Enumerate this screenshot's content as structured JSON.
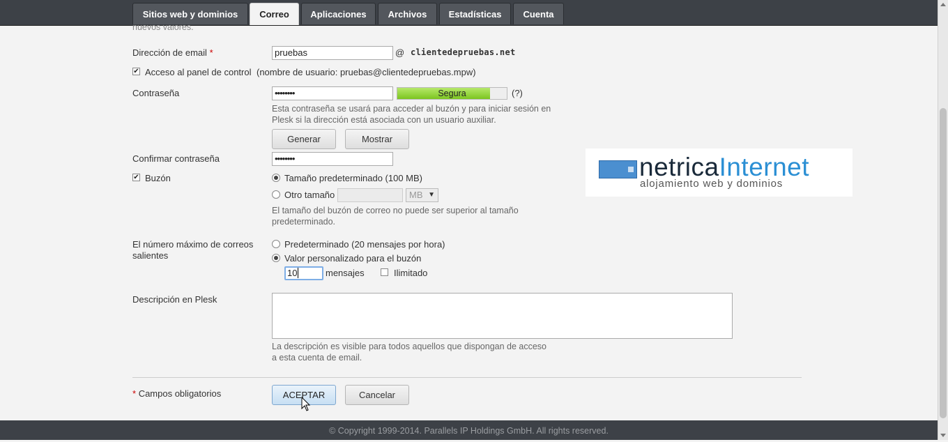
{
  "tabs": [
    {
      "label": "Sitios web y dominios"
    },
    {
      "label": "Correo"
    },
    {
      "label": "Aplicaciones"
    },
    {
      "label": "Archivos"
    },
    {
      "label": "Estadísticas"
    },
    {
      "label": "Cuenta"
    }
  ],
  "form": {
    "cut_text": "nuevos valores.",
    "email_label": "Dirección de email",
    "required_mark": "*",
    "email_value": "pruebas",
    "at_sign": "@",
    "domain": "clientedepruebas.net",
    "panel_access_label": "Acceso al panel de control",
    "panel_access_username": "(nombre de usuario: pruebas@clientedepruebas.mpw)",
    "password_label": "Contraseña",
    "password_value": "••••••••",
    "strength_label": "Segura",
    "strength_level": 0.85,
    "strength_help": "(?)",
    "password_hint": "Esta contraseña se usará para acceder al buzón y para iniciar sesión en Plesk si la dirección está asociada con un usuario auxiliar.",
    "generate_button": "Generar",
    "show_button": "Mostrar",
    "confirm_label": "Confirmar contraseña",
    "confirm_value": "••••••••",
    "mailbox_label": "Buzón",
    "default_size_label": "Tamaño predeterminado (100 MB)",
    "other_size_label": "Otro tamaño",
    "size_unit": "MB",
    "size_hint": "El tamaño del buzón de correo no puede ser superior al tamaño predeterminado.",
    "max_outgoing_label": "El número máximo de correos salientes",
    "default_outgoing_label": "Predeterminado (20 mensajes por hora)",
    "custom_outgoing_label": "Valor personalizado para el buzón",
    "messages_value": "10",
    "messages_label": "mensajes",
    "unlimited_label": "Ilimitado",
    "description_label": "Descripción en Plesk",
    "description_value": "",
    "description_hint": "La descripción es visible para todos aquellos que dispongan de acceso a esta cuenta de email.",
    "required_fields_label": "Campos obligatorios",
    "ok_button": "ACEPTAR",
    "cancel_button": "Cancelar"
  },
  "logo": {
    "word1": "netrica",
    "word2": "Internet",
    "tagline": "alojamiento web y dominios",
    "color1": "#1a2a3a",
    "color2": "#2b8fd4"
  },
  "footer": {
    "copyright": "© Copyright 1999-2014. Parallels IP Holdings GmbH. All rights reserved."
  }
}
